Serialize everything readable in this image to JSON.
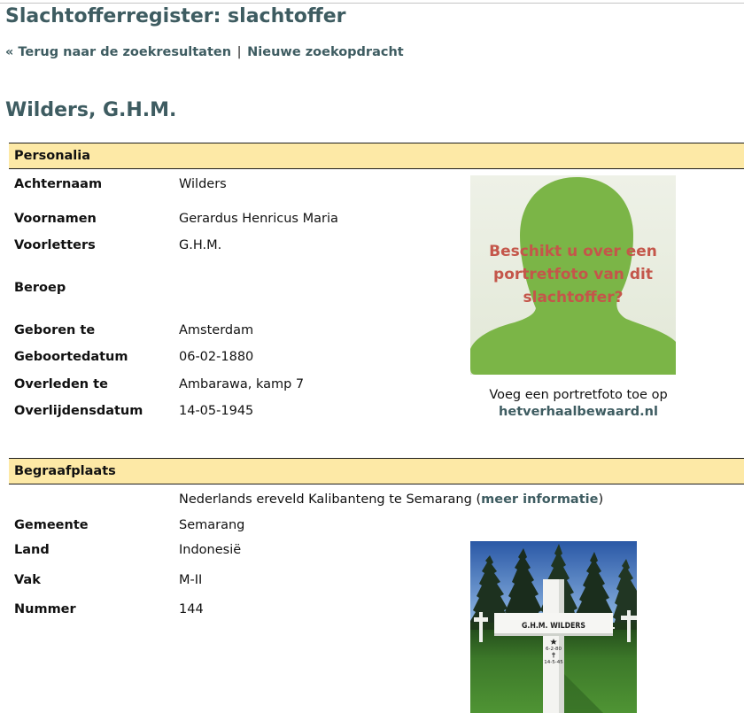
{
  "page": {
    "title": "Slachtofferregister: slachtoffer",
    "nav": {
      "back_label": "« Terug naar de zoekresultaten",
      "separator": "|",
      "new_search_label": "Nieuwe zoekopdracht"
    },
    "name": "Wilders, G.H.M."
  },
  "personalia": {
    "heading": "Personalia",
    "fields": [
      {
        "label": "Achternaam",
        "value": "Wilders"
      },
      {
        "label": "Voornamen",
        "value": "Gerardus Henricus Maria"
      },
      {
        "label": "Voorletters",
        "value": "G.H.M."
      },
      {
        "label": "Beroep"
      },
      {
        "label": "Geboren te",
        "value": "Amsterdam"
      },
      {
        "label": "Geboortedatum",
        "value": "06-02-1880"
      },
      {
        "label": "Overleden te",
        "value": "Ambarawa, kamp 7"
      },
      {
        "label": "Overlijdensdatum",
        "value": "14-05-1945"
      }
    ],
    "portrait_placeholder": {
      "prompt_lines": [
        "Beschikt u over een",
        "portretfoto van dit",
        "slachtoffer?"
      ],
      "caption": "Voeg een portretfoto toe op",
      "link": "hetverhaalbewaard.nl"
    }
  },
  "begraafplaats": {
    "heading": "Begraafplaats",
    "cemetery": {
      "name": "Nederlands ereveld Kalibanteng te Semarang",
      "paren_open": "(",
      "more_info_label": "meer informatie",
      "paren_close": ")"
    },
    "fields": [
      {
        "label": "Gemeente",
        "value": "Semarang"
      },
      {
        "label": "Land",
        "value": "Indonesië"
      },
      {
        "label": "Vak",
        "value": "M-II"
      },
      {
        "label": "Nummer",
        "value": "144"
      }
    ]
  },
  "grave_photo": {
    "plaque_text": "G.H.M. WILDERS",
    "birth_text": "6-2-80",
    "death_text": "14-5-45"
  },
  "colors": {
    "accent": "#3e5c61",
    "section_header_bg": "#fde9a6",
    "prompt_text": "#c4564a",
    "silhouette": "#7bb547"
  }
}
